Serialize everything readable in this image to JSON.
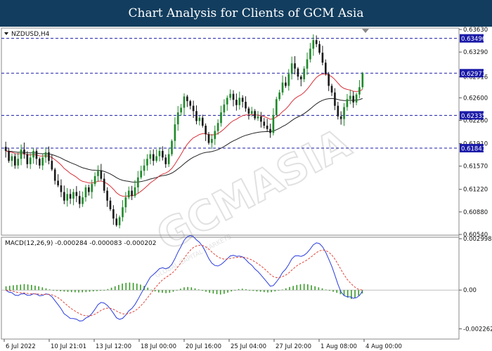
{
  "header": {
    "title": "Chart Analysis for Clients of GCM Asia"
  },
  "watermark": {
    "brand": "GCMASIA",
    "tagline": "GLOBAL CAPITAL MARKETS"
  },
  "colors": {
    "header_bg": "#123d5e",
    "bull": "#1f8a2a",
    "bear": "#1a1a1a",
    "ema_fast": "#d9303a",
    "ema_slow": "#222222",
    "level_line": "#1a1aa8",
    "label_bg": "#1a1aa8",
    "macd_line": "#2a3cdd",
    "signal_line": "#e0443a",
    "hist": "#3a9a2a"
  },
  "chart_data": [
    {
      "type": "candlestick",
      "title": "NZDUSD,H4",
      "ylim": [
        0.6054,
        0.6363
      ],
      "y_ticks": [
        "0.63630",
        "0.63290",
        "0.62916",
        "0.62600",
        "0.62260",
        "0.61910",
        "0.61570",
        "0.61220",
        "0.60880",
        "0.60540"
      ],
      "x_ticks": [
        "6 Jul 2022",
        "10 Jul 21:01",
        "13 Jul 12:00",
        "18 Jul 00:00",
        "20 Jul 16:00",
        "25 Jul 04:00",
        "27 Jul 20:00",
        "1 Aug 08:00",
        "4 Aug 00:00"
      ],
      "levels": [
        0.63496,
        0.62971,
        0.62335,
        0.61841
      ],
      "level_labels": [
        "0.63496",
        "0.62971",
        "0.62335",
        "0.61841"
      ],
      "grid": false,
      "closes": [
        0.618,
        0.6165,
        0.6172,
        0.6158,
        0.6168,
        0.6182,
        0.6175,
        0.616,
        0.617,
        0.618,
        0.6168,
        0.6158,
        0.617,
        0.6178,
        0.6165,
        0.6152,
        0.6135,
        0.6128,
        0.6118,
        0.6105,
        0.6115,
        0.6108,
        0.6118,
        0.6112,
        0.61,
        0.611,
        0.6125,
        0.6118,
        0.613,
        0.6142,
        0.615,
        0.6138,
        0.612,
        0.6105,
        0.6092,
        0.6078,
        0.6068,
        0.608,
        0.6095,
        0.611,
        0.612,
        0.6112,
        0.6125,
        0.614,
        0.615,
        0.6158,
        0.6168,
        0.6175,
        0.6165,
        0.6172,
        0.618,
        0.617,
        0.616,
        0.6175,
        0.6195,
        0.622,
        0.6238,
        0.6245,
        0.6262,
        0.6255,
        0.6248,
        0.624,
        0.6225,
        0.623,
        0.6218,
        0.6205,
        0.6192,
        0.6198,
        0.621,
        0.6222,
        0.6238,
        0.625,
        0.626,
        0.6266,
        0.6257,
        0.6249,
        0.626,
        0.6254,
        0.6244,
        0.6236,
        0.624,
        0.6229,
        0.6232,
        0.6224,
        0.6218,
        0.6213,
        0.6207,
        0.6234,
        0.6258,
        0.6268,
        0.6283,
        0.6278,
        0.6296,
        0.6312,
        0.6304,
        0.6292,
        0.6288,
        0.6304,
        0.6318,
        0.6334,
        0.6347,
        0.6341,
        0.6328,
        0.6313,
        0.6296,
        0.6278,
        0.6268,
        0.6248,
        0.6232,
        0.6228,
        0.6246,
        0.6258,
        0.6263,
        0.6253,
        0.6265,
        0.6276,
        0.6297
      ]
    },
    {
      "type": "line",
      "title": "MACD(12,26,9) -0.000284 -0.000083 -0.000202",
      "ylim": [
        -0.00282,
        0.003
      ],
      "y_ticks": [
        "0.002998",
        "0.00",
        "-0.002262"
      ],
      "series": [],
      "hist": [
        0.00022,
        0.00025,
        0.00028,
        0.0003,
        0.00032,
        0.00035,
        0.00033,
        0.0003,
        0.00026,
        0.00022,
        0.00016,
        0.0001,
        4e-05,
        -2e-05,
        -5e-05,
        -7e-05,
        -9e-05,
        -0.00011,
        -0.00012,
        -0.00013,
        -0.00014,
        -0.00013,
        -0.00012,
        -0.0001,
        -8e-05,
        -6e-05,
        -4e-05,
        0.0,
        6e-05,
        0.00014,
        0.00022,
        0.0003,
        0.00038,
        0.00042,
        0.00044,
        0.00042,
        0.00038,
        0.00032,
        0.00024,
        0.00014,
        2e-05,
        -8e-05,
        -0.00014,
        -0.00016,
        -0.00018,
        -0.00016,
        -0.0001,
        -2e-05,
        8e-05,
        0.00016,
        0.00018,
        0.00016,
        0.0001,
        4e-05,
        -4e-05,
        -0.0001,
        -0.00016,
        -0.0002,
        -0.00024,
        -0.00026,
        -0.00022,
        -0.00015,
        -8e-05,
        0.0,
        6e-05,
        8e-05,
        5e-05,
        0.0,
        -5e-05,
        -8e-05,
        -0.0001,
        -0.00012,
        -0.00014,
        -0.00012,
        -8e-05,
        -3e-05,
        3e-05,
        0.0001,
        0.00018,
        0.00024,
        0.0003,
        0.00034,
        0.00036,
        0.00034,
        0.00028,
        0.00022,
        0.00016,
        0.0001,
        3e-05,
        -4e-05,
        -0.0001,
        -0.00016,
        -0.00024,
        -0.00034,
        -0.00044,
        -0.00052,
        -0.00046,
        -0.00032,
        -0.0002
      ]
    }
  ]
}
